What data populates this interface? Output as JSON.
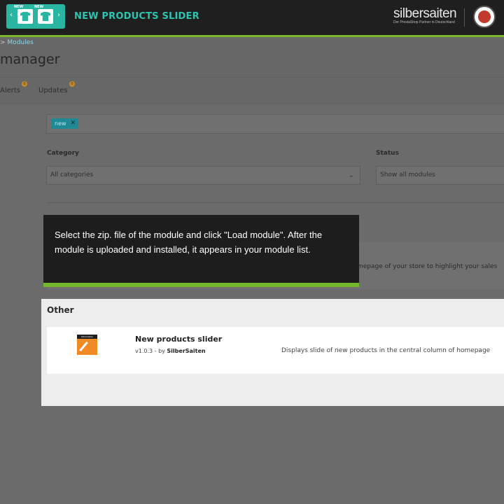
{
  "banner": {
    "logo_tag_1": "NEW",
    "logo_tag_2": "NEW",
    "logo_prev": "‹",
    "logo_next": "›",
    "title": "NEW PRODUCTS SLIDER",
    "brand_name": "silbersaiten",
    "brand_tagline": "Der PrestaShop Partner in Deutschland",
    "accent_color": "#7ab52b"
  },
  "breadcrumb": {
    "separator": ">",
    "item": "Modules"
  },
  "page_title": "manager",
  "tabs": [
    {
      "label": "Alerts",
      "count": "0"
    },
    {
      "label": "Updates",
      "count": "0"
    }
  ],
  "search": {
    "tag": "new",
    "tag_remove": "✕"
  },
  "filters": {
    "category_label": "Category",
    "category_value": "All categories",
    "status_label": "Status",
    "status_value": "Show all modules"
  },
  "hidden_panel_text": "mepage of your store to highlight your sales",
  "tooltip": {
    "text": "Select the zip. file of the module and click \"Load module\". After the module is uploaded and installed, it appears in your module list."
  },
  "section": {
    "title": "Other",
    "module": {
      "icon_label": "silbersaiten",
      "name": "New products slider",
      "version": "v1.0.3 - by ",
      "author": "SilberSaiten",
      "description": "Displays slide of new products in the central column of homepage"
    }
  }
}
